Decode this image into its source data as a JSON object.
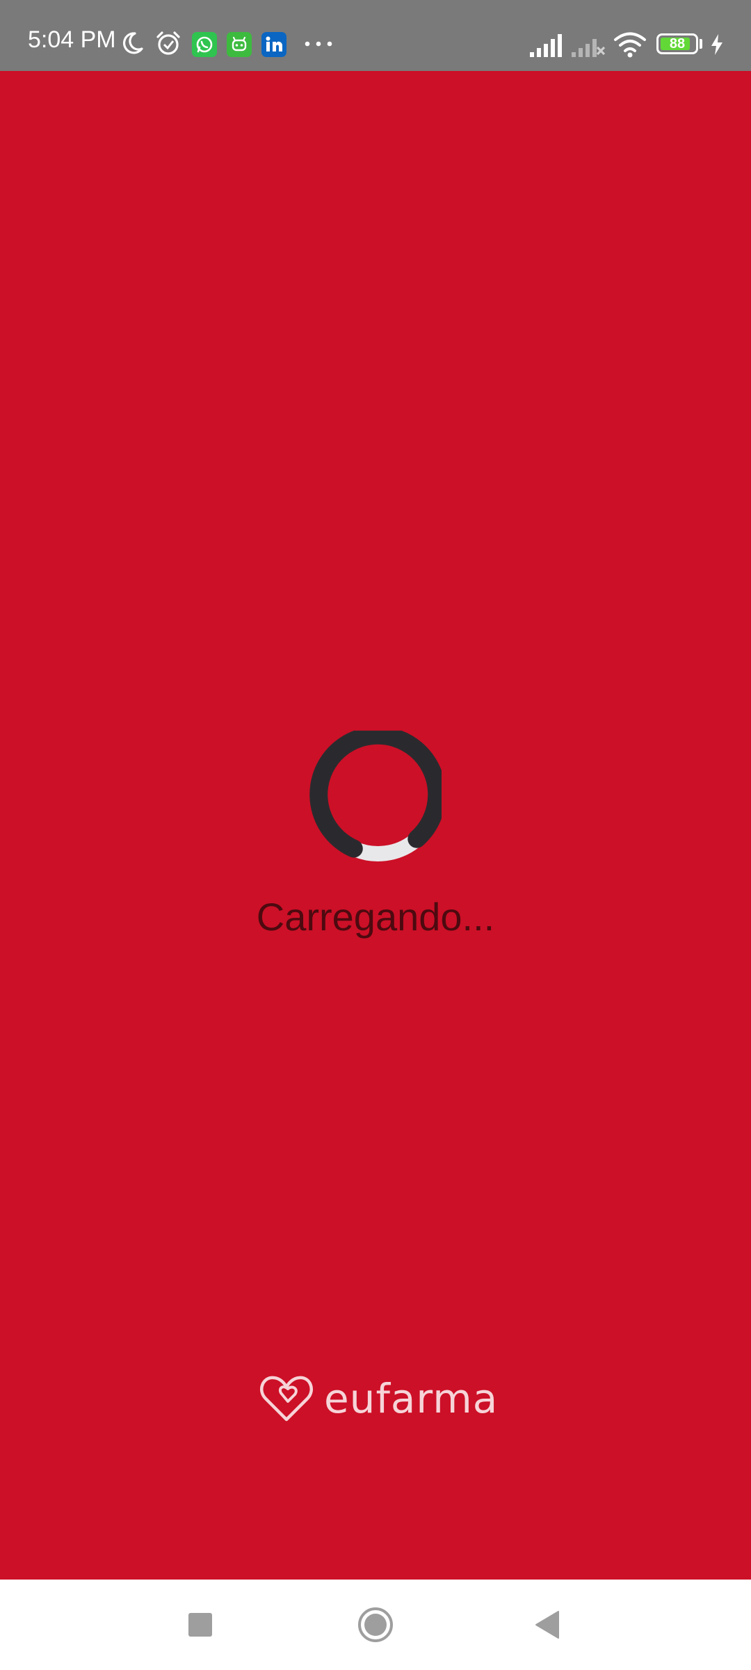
{
  "status_bar": {
    "time": "5:04 PM",
    "battery_level": "88",
    "icons": [
      "moon-icon",
      "alarm-icon",
      "whatsapp-icon",
      "android-app-icon",
      "linkedin-icon",
      "more-dots-icon",
      "signal-icon",
      "signal-off-icon",
      "wifi-icon",
      "battery-icon",
      "charging-icon"
    ],
    "colors": {
      "background": "#7a7a7a",
      "whatsapp": "#2fc44f",
      "android_app": "#3dbb3f",
      "linkedin": "#0a66c2",
      "battery_fill": "#61d836"
    }
  },
  "loader": {
    "text": "Carregando..."
  },
  "brand": {
    "name": "eufarma"
  },
  "navigation": {
    "buttons": [
      "recents-button",
      "home-button",
      "back-button"
    ]
  },
  "colors": {
    "background": "#cc1027",
    "spinner": "#2a2a2e",
    "spinner_track": "#e8e8ea",
    "loading_text": "#4d0a10"
  }
}
